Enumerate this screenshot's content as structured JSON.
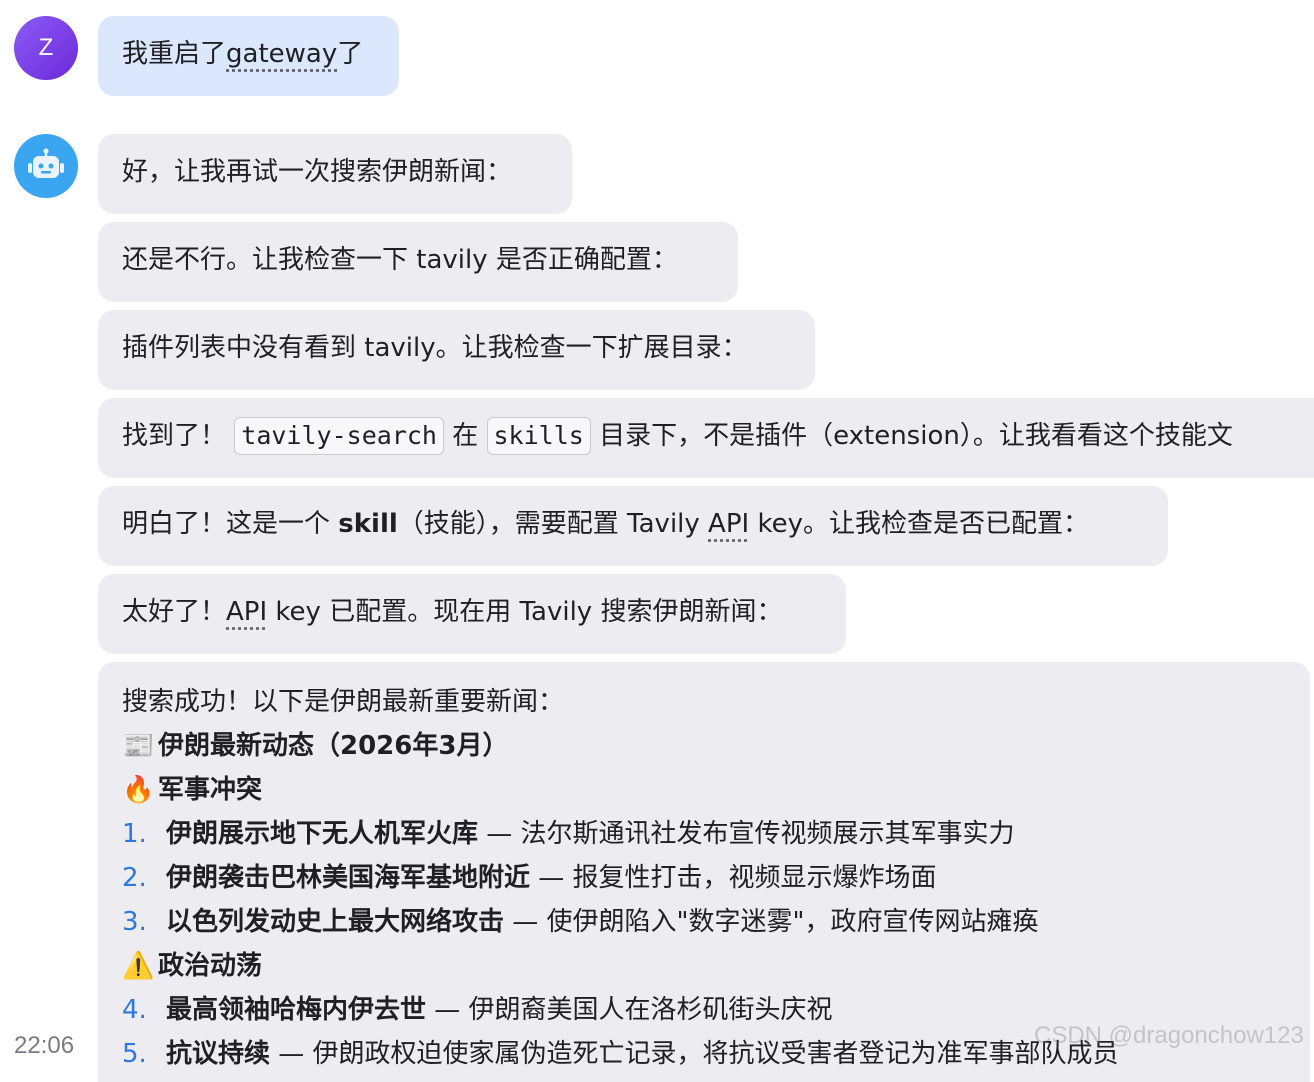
{
  "user": {
    "avatar_letter": "Z",
    "message_prefix": "我重启了",
    "message_link": "gateway",
    "message_suffix": "了"
  },
  "bot": {
    "m1": "好，让我再试一次搜索伊朗新闻：",
    "m2": "还是不行。让我检查一下 tavily 是否正确配置：",
    "m3": "插件列表中没有看到 tavily。让我检查一下扩展目录：",
    "m4": {
      "a": "找到了！",
      "code1": "tavily-search",
      "b": "在",
      "code2": "skills",
      "c": "目录下，不是插件（extension）。让我看看这个技能文"
    },
    "m5": {
      "a": "明白了！这是一个 ",
      "bold": "skill",
      "b": "（技能），需要配置 Tavily ",
      "abbr": "API",
      "c": " key。让我检查是否已配置："
    },
    "m6": {
      "a": "太好了！",
      "abbr": "API",
      "b": " key 已配置。现在用 Tavily 搜索伊朗新闻："
    },
    "m7": {
      "intro": "搜索成功！以下是伊朗最新重要新闻：",
      "h1_icon": "📰",
      "h1": "伊朗最新动态（2026年3月）",
      "h2_icon": "🔥",
      "h2": "军事冲突",
      "items_a": [
        {
          "num": "1.",
          "title": "伊朗展示地下无人机军火库",
          "desc": " — 法尔斯通讯社发布宣传视频展示其军事实力"
        },
        {
          "num": "2.",
          "title": "伊朗袭击巴林美国海军基地附近",
          "desc": " — 报复性打击，视频显示爆炸场面"
        },
        {
          "num": "3.",
          "title": "以色列发动史上最大网络攻击",
          "desc": " — 使伊朗陷入\"数字迷雾\"，政府宣传网站瘫痪"
        }
      ],
      "h3_icon": "⚠️",
      "h3": "政治动荡",
      "items_b": [
        {
          "num": "4.",
          "title": "最高领袖哈梅内伊去世",
          "desc": " — 伊朗裔美国人在洛杉矶街头庆祝"
        },
        {
          "num": "5.",
          "title": "抗议持续",
          "desc": " — 伊朗政权迫使家属伪造死亡记录，将抗议受害者登记为准军事部队成员"
        }
      ]
    }
  },
  "timestamp": "22:06",
  "watermark": "CSDN @dragonchow123"
}
